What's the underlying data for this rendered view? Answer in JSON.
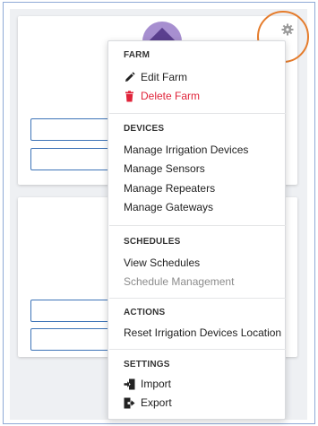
{
  "menu": {
    "sections": [
      {
        "title": "FARM",
        "items": [
          {
            "label": "Edit Farm",
            "icon": "pencil-icon"
          },
          {
            "label": "Delete Farm",
            "icon": "trash-icon",
            "color": "#e0243a"
          }
        ]
      },
      {
        "title": "DEVICES",
        "items": [
          {
            "label": "Manage Irrigation Devices"
          },
          {
            "label": "Manage Sensors"
          },
          {
            "label": "Manage Repeaters"
          },
          {
            "label": "Manage Gateways"
          }
        ]
      },
      {
        "title": "SCHEDULES",
        "items": [
          {
            "label": "View Schedules"
          },
          {
            "label": "Schedule Management",
            "state": "disabled"
          }
        ]
      },
      {
        "title": "ACTIONS",
        "items": [
          {
            "label": "Reset Irrigation Devices Location"
          }
        ]
      },
      {
        "title": "SETTINGS",
        "items": [
          {
            "label": "Import",
            "icon": "import-icon"
          },
          {
            "label": "Export",
            "icon": "export-icon"
          }
        ]
      }
    ]
  },
  "colors": {
    "accent_ring": "#e57c2c",
    "danger": "#e0243a",
    "field_border": "#3e74b8",
    "avatar": "#a78fd0"
  }
}
